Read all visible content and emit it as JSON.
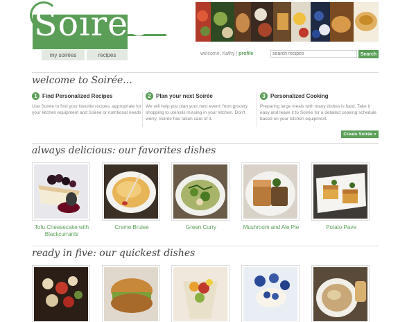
{
  "header": {
    "logo_text": "Soirée",
    "nav": {
      "my_soirees": "my soirées",
      "recipes": "recipes"
    },
    "welcome_text": "welcome, Kathy",
    "separator": "|",
    "profile_link": "profile",
    "search_placeholder": "search recipes",
    "search_button": "Search"
  },
  "intro": {
    "title": "welcome to Soirée...",
    "steps": [
      {
        "number": "1",
        "title": "Find Personalized Recipes",
        "body": "Use Soirée to find your favorite recipes, appropriate for your kitchen equipment and Soirée or nutritional needs"
      },
      {
        "number": "2",
        "title": "Plan your next Soirée",
        "body": "We will help you plan your next event: from grocery shopping to utensils missing in your kitchen. Don't worry, Soirée has taken care of it."
      },
      {
        "number": "3",
        "title": "Personalized Cooking",
        "body": "Preparing large meals with many dishes is hard. Take it easy and leave it to Soirée for a detailed cooking schedule based on your kitchen equipment."
      }
    ],
    "create_button": "Create Soirée »"
  },
  "favorites": {
    "title": "always delicious: our favorites dishes",
    "dishes": [
      {
        "name": "Tofu Cheesecake with Blackcurrants"
      },
      {
        "name": "Creme Brulee"
      },
      {
        "name": "Green Curry"
      },
      {
        "name": "Mushroom and Ale Pie"
      },
      {
        "name": "Potato Pave"
      }
    ]
  },
  "quickest": {
    "title": "ready in five: our quickest dishes"
  },
  "colors": {
    "brand_green": "#5a9e57",
    "nav_bg": "#e3e9e1"
  }
}
